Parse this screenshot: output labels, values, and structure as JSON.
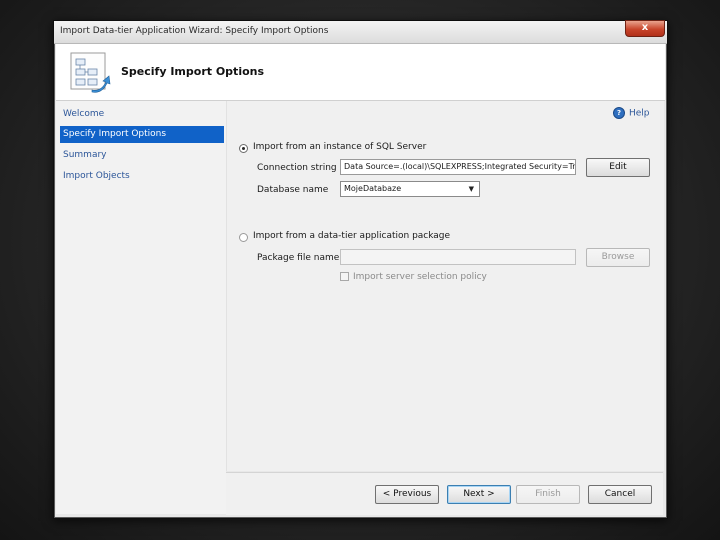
{
  "window": {
    "title": "Import Data-tier Application Wizard: Specify Import Options",
    "close_label": "x"
  },
  "header": {
    "title": "Specify Import Options",
    "icon": "wizard-diagram-icon"
  },
  "nav": {
    "items": [
      {
        "label": "Welcome",
        "selected": false
      },
      {
        "label": "Specify Import Options",
        "selected": true
      },
      {
        "label": "Summary",
        "selected": false
      },
      {
        "label": "Import Objects",
        "selected": false
      }
    ]
  },
  "content": {
    "help_label": "Help",
    "option_sql": {
      "label": "Import from an instance of SQL Server",
      "selected": true,
      "connection_label": "Connection string :",
      "connection_value": "Data Source=.(local)\\SQLEXPRESS;Integrated Security=True",
      "edit_button": "Edit",
      "database_label": "Database name",
      "database_value": "MojeDatabaze"
    },
    "option_package": {
      "label": "Import from a data-tier application package",
      "selected": false,
      "file_label": "Package file name:",
      "file_value": "",
      "browse_button": "Browse",
      "policy_checkbox_label": "Import server selection policy"
    }
  },
  "footer": {
    "previous": "< Previous",
    "next": "Next >",
    "finish": "Finish",
    "cancel": "Cancel"
  },
  "colors": {
    "nav_selected_bg": "#1062c8",
    "link_text": "#2c5699",
    "close_button": "#c8452b"
  }
}
